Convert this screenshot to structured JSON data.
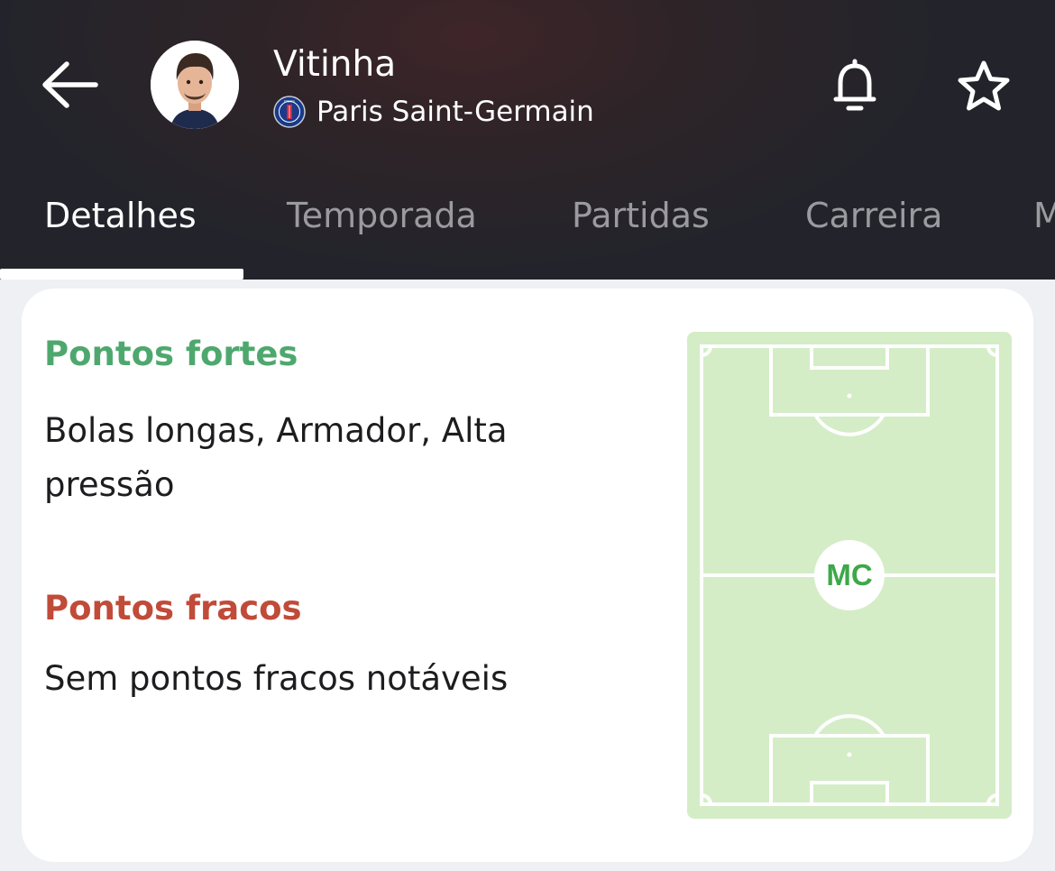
{
  "header": {
    "player_name": "Vitinha",
    "club_name": "Paris Saint-Germain",
    "club_badge_text": "PARIS",
    "back_icon": "arrow-left-icon",
    "notify_icon": "bell-icon",
    "favorite_icon": "star-outline-icon"
  },
  "tabs": [
    {
      "label": "Detalhes",
      "active": true
    },
    {
      "label": "Temporada",
      "active": false
    },
    {
      "label": "Partidas",
      "active": false
    },
    {
      "label": "Carreira",
      "active": false
    },
    {
      "label": "M",
      "active": false
    }
  ],
  "card": {
    "strengths_title": "Pontos fortes",
    "strengths_text": "Bolas longas, Armador, Alta pressão",
    "weaknesses_title": "Pontos fracos",
    "weaknesses_text": "Sem pontos fracos notáveis",
    "position_label": "MC"
  },
  "colors": {
    "header_bg": "#23242b",
    "strengths": "#4ea86e",
    "weaknesses": "#c04b38",
    "pitch": "#d4edc7",
    "position_text": "#3da84a"
  }
}
